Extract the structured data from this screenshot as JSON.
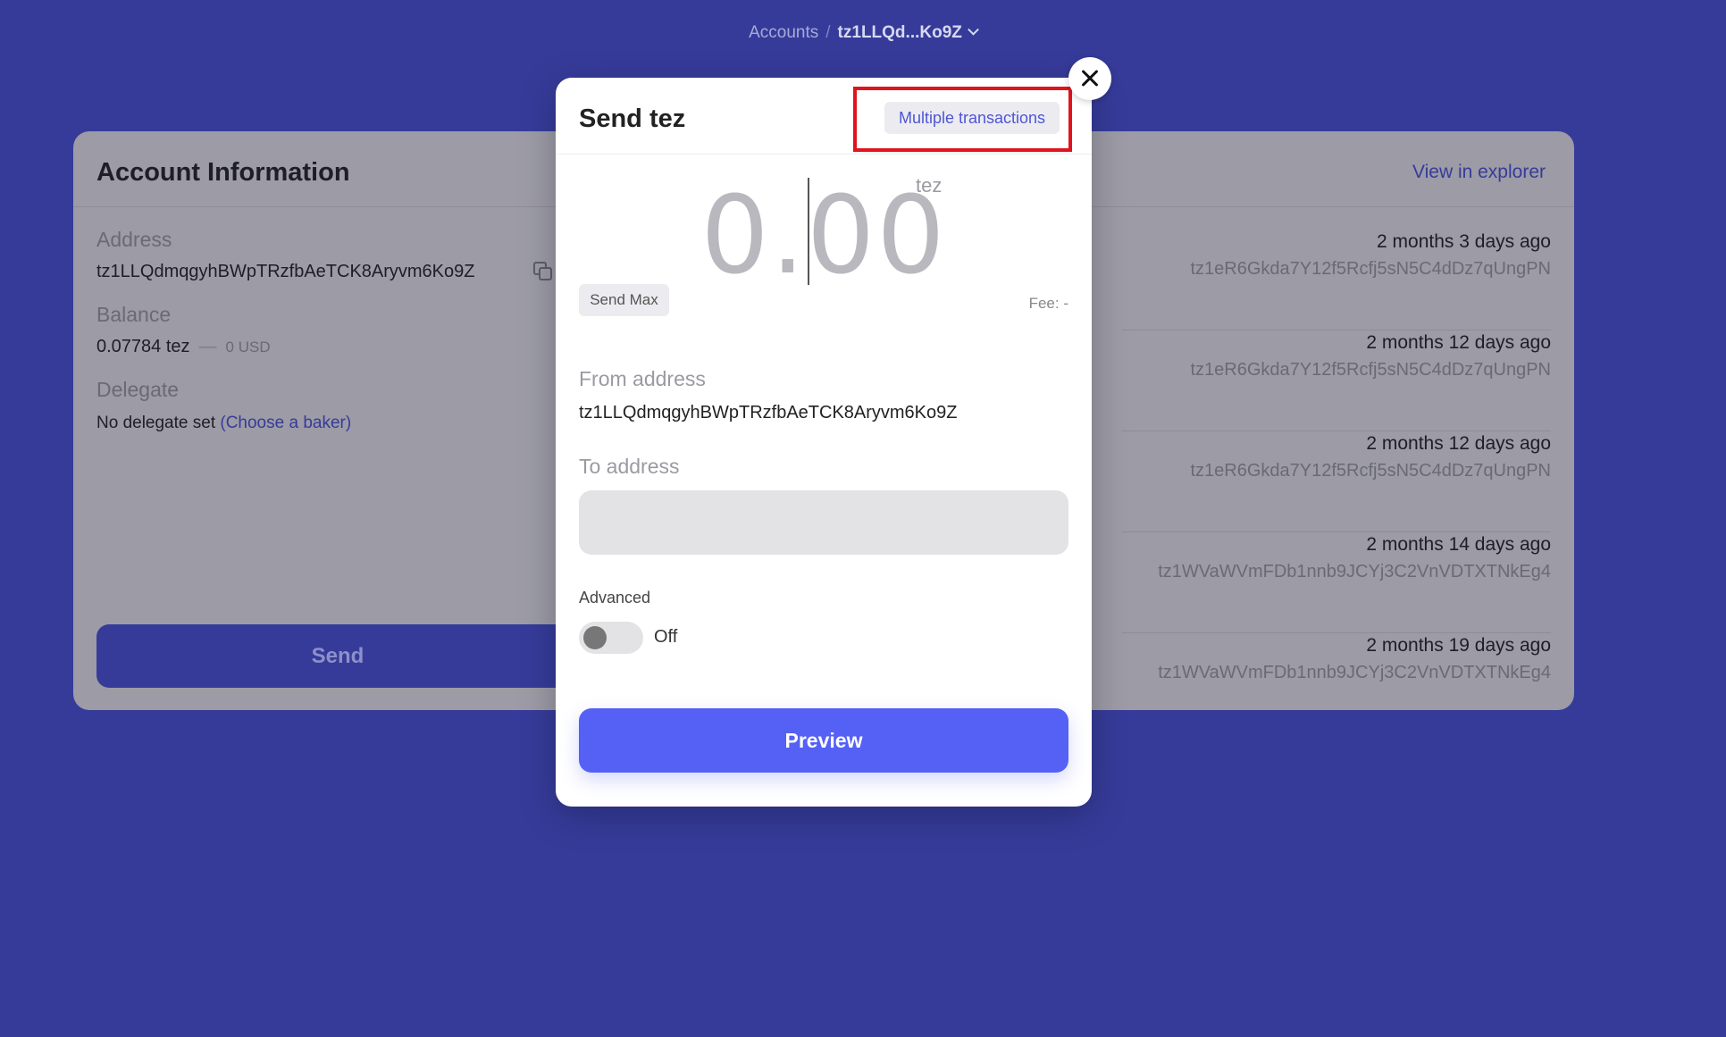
{
  "breadcrumb": {
    "root": "Accounts",
    "separator": "/",
    "current": "tz1LLQd...Ko9Z"
  },
  "account_card": {
    "title": "Account Information",
    "view_explorer": "View in explorer",
    "address_label": "Address",
    "address_value": "tz1LLQdmqgyhBWpTRzfbAeTCK8Aryvm6Ko9Z",
    "balance_label": "Balance",
    "balance_value": "0.07784 tez",
    "balance_dash": "—",
    "balance_usd": "0 USD",
    "delegate_label": "Delegate",
    "delegate_text": "No delegate set ",
    "delegate_link": "(Choose a baker)",
    "send_button": "Send"
  },
  "transactions": [
    {
      "when": "2 months 3 days ago",
      "address": "tz1eR6Gkda7Y12f5Rcfj5sN5C4dDz7qUngPN"
    },
    {
      "when": "2 months 12 days ago",
      "address": "tz1eR6Gkda7Y12f5Rcfj5sN5C4dDz7qUngPN"
    },
    {
      "when": "2 months 12 days ago",
      "address": "tz1eR6Gkda7Y12f5Rcfj5sN5C4dDz7qUngPN"
    },
    {
      "when": "2 months 14 days ago",
      "address": "tz1WVaWVmFDb1nnb9JCYj3C2VnVDTXTNkEg4"
    },
    {
      "when": "2 months 19 days ago",
      "address": "tz1WVaWVmFDb1nnb9JCYj3C2VnVDTXTNkEg4"
    }
  ],
  "modal": {
    "title": "Send tez",
    "multiple_transactions": "Multiple transactions",
    "amount": "0.00",
    "amount_unit": "tez",
    "send_max": "Send Max",
    "fee": "Fee: -",
    "from_label": "From address",
    "from_value": "tz1LLQdmqgyhBWpTRzfbAeTCK8Aryvm6Ko9Z",
    "to_label": "To address",
    "to_value": "",
    "advanced_label": "Advanced",
    "advanced_state": "Off",
    "preview_button": "Preview"
  },
  "colors": {
    "background": "#363b9a",
    "accent": "#5560f5",
    "highlight": "#e0141e"
  }
}
